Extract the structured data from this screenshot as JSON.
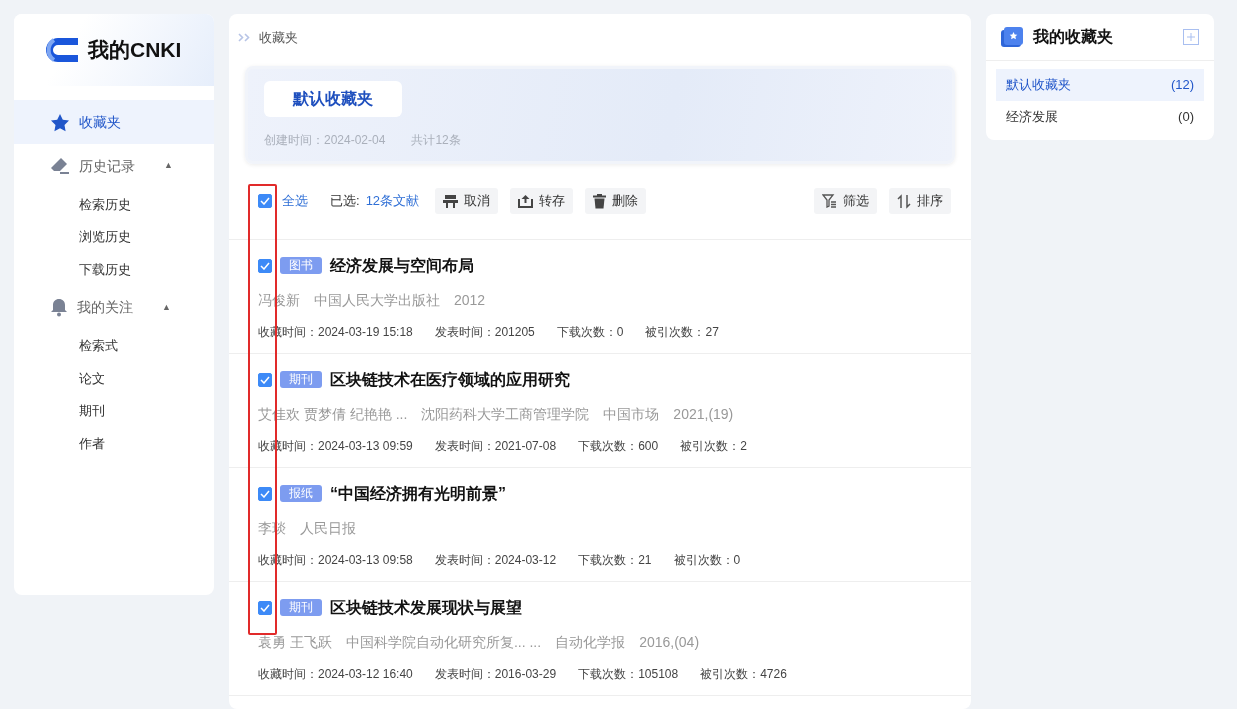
{
  "sidebar": {
    "logo": "我的CNKI",
    "items": [
      {
        "label": "收藏夹",
        "kind": "star",
        "selected": true
      },
      {
        "label": "历史记录",
        "kind": "eraser",
        "selected": false,
        "expanded": true,
        "caret": "▲",
        "children": [
          {
            "label": "检索历史"
          },
          {
            "label": "浏览历史"
          },
          {
            "label": "下载历史"
          }
        ]
      },
      {
        "label": "我的关注",
        "kind": "bell",
        "selected": false,
        "expanded": true,
        "caret": "▲",
        "children": [
          {
            "label": "检索式"
          },
          {
            "label": "论文"
          },
          {
            "label": "期刊"
          },
          {
            "label": "作者"
          }
        ]
      }
    ]
  },
  "breadcrumb": "收藏夹",
  "folder": {
    "name": "默认收藏夹",
    "created": "创建时间：2024-02-04",
    "count": "共计12条"
  },
  "toolbar": {
    "select_all": {
      "label": "全选",
      "checked": true
    },
    "selected_label": "已选:",
    "selected_count": "12条文献",
    "actions": [
      {
        "label": "取消",
        "kind": "cancel"
      },
      {
        "label": "转存",
        "kind": "export"
      },
      {
        "label": "删除",
        "kind": "trash"
      }
    ],
    "tools": [
      {
        "label": "筛选",
        "kind": "filter"
      },
      {
        "label": "排序",
        "kind": "sort"
      }
    ]
  },
  "records": [
    {
      "checked": true,
      "type": "图书",
      "title": "经济发展与空间布局",
      "byline": [
        "冯俊新",
        "中国人民大学出版社",
        "2012"
      ],
      "meta": [
        "收藏时间：2024-03-19 15:18",
        "发表时间：201205",
        "下载次数：0",
        "被引次数：27"
      ]
    },
    {
      "checked": true,
      "type": "期刊",
      "title": "区块链技术在医疗领域的应用研究",
      "byline": [
        "艾佳欢 贾梦倩 纪艳艳 ...",
        "沈阳药科大学工商管理学院",
        "中国市场",
        "2021,(19)"
      ],
      "meta": [
        "收藏时间：2024-03-13 09:59",
        "发表时间：2021-07-08",
        "下载次数：600",
        "被引次数：2"
      ]
    },
    {
      "checked": true,
      "type": "报纸",
      "title": "“中国经济拥有光明前景”",
      "byline": [
        "李琰",
        "人民日报"
      ],
      "meta": [
        "收藏时间：2024-03-13 09:58",
        "发表时间：2024-03-12",
        "下载次数：21",
        "被引次数：0"
      ]
    },
    {
      "checked": true,
      "type": "期刊",
      "title": "区块链技术发展现状与展望",
      "byline": [
        "袁勇 王飞跃",
        "中国科学院自动化研究所复... ...",
        "自动化学报",
        "2016,(04)"
      ],
      "meta": [
        "收藏时间：2024-03-12 16:40",
        "发表时间：2016-03-29",
        "下载次数：105108",
        "被引次数：4726"
      ]
    }
  ],
  "favorites": {
    "title": "我的收藏夹",
    "folders": [
      {
        "name": "默认收藏夹",
        "count": "(12)",
        "selected": true
      },
      {
        "name": "经济发展",
        "count": "(0)",
        "selected": false
      }
    ]
  }
}
